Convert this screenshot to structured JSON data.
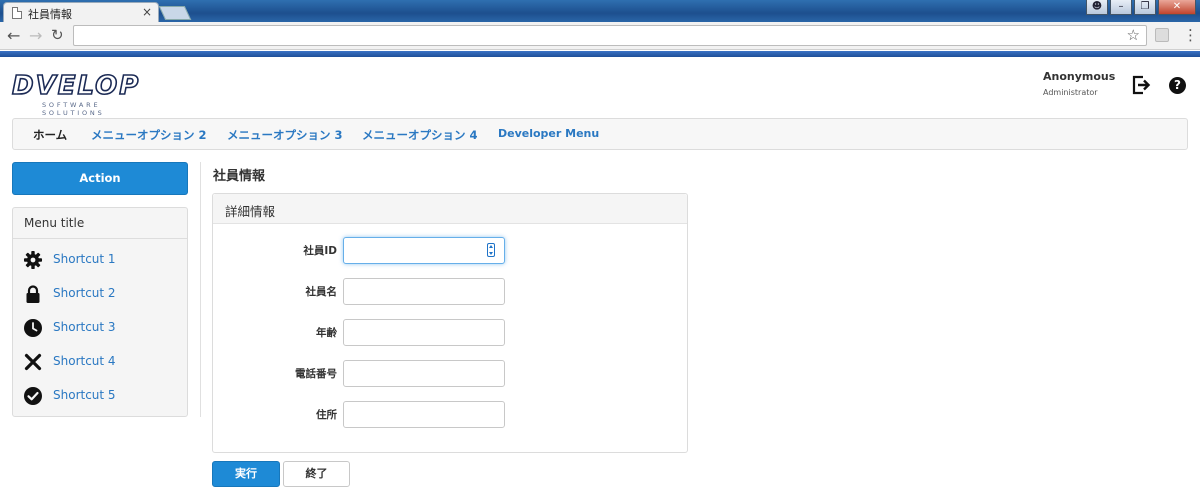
{
  "browser": {
    "tab_title": "社員情報",
    "tab_close": "×",
    "address_value": "",
    "icons": [
      "back-icon",
      "forward-icon",
      "reload-icon",
      "star-icon",
      "extension-icon",
      "menu-icon"
    ]
  },
  "header": {
    "logo_text": "DVELOP",
    "logo_subtitle": "SOFTWARE SOLUTIONS",
    "user_name": "Anonymous",
    "user_role": "Administrator",
    "help_glyph": "?"
  },
  "nav": {
    "items": [
      {
        "label": "ホーム"
      },
      {
        "label": "メニューオプション 2"
      },
      {
        "label": "メニューオプション 3"
      },
      {
        "label": "メニューオプション 4"
      },
      {
        "label": "Developer Menu"
      }
    ]
  },
  "sidebar": {
    "action_label": "Action",
    "menu_title": "Menu title",
    "shortcuts": [
      {
        "label": "Shortcut 1",
        "icon": "gear-icon"
      },
      {
        "label": "Shortcut 2",
        "icon": "lock-icon"
      },
      {
        "label": "Shortcut 3",
        "icon": "clock-icon"
      },
      {
        "label": "Shortcut 4",
        "icon": "close-icon"
      },
      {
        "label": "Shortcut 5",
        "icon": "check-circle-icon"
      }
    ]
  },
  "main": {
    "page_title": "社員情報",
    "panel_title": "詳細情報",
    "fields": [
      {
        "label": "社員ID",
        "value": ""
      },
      {
        "label": "社員名",
        "value": ""
      },
      {
        "label": "年齢",
        "value": ""
      },
      {
        "label": "電話番号",
        "value": ""
      },
      {
        "label": "住所",
        "value": ""
      }
    ],
    "submit_label": "実行",
    "cancel_label": "終了"
  },
  "colors": {
    "primary": "#1e8ad6",
    "link": "#2a78c2",
    "accent_bar": "#2a5fae"
  }
}
